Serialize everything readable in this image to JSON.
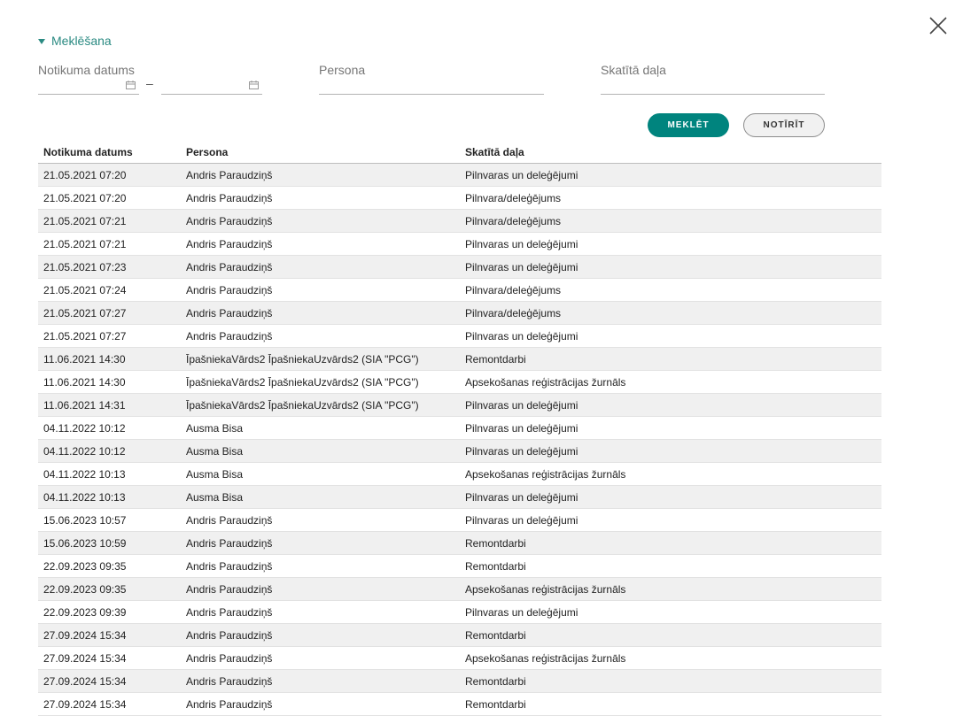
{
  "search": {
    "toggle_label": "Meklēšana",
    "date_label": "Notikuma datums",
    "date_separator": "–",
    "person_label": "Persona",
    "section_label": "Skatītā daļa",
    "search_button": "MEKLĒT",
    "clear_button": "NOTĪRĪT"
  },
  "icons": {
    "close": "close-icon",
    "calendar": "calendar-icon",
    "caret": "caret-down-icon"
  },
  "colors": {
    "accent": "#00847e",
    "link": "#2a8a82"
  },
  "table": {
    "headers": [
      "Notikuma datums",
      "Persona",
      "Skatītā daļa"
    ],
    "rows": [
      [
        "21.05.2021 07:20",
        "Andris Paraudziņš",
        "Pilnvaras un deleģējumi"
      ],
      [
        "21.05.2021 07:20",
        "Andris Paraudziņš",
        "Pilnvara/deleģējums"
      ],
      [
        "21.05.2021 07:21",
        "Andris Paraudziņš",
        "Pilnvara/deleģējums"
      ],
      [
        "21.05.2021 07:21",
        "Andris Paraudziņš",
        "Pilnvaras un deleģējumi"
      ],
      [
        "21.05.2021 07:23",
        "Andris Paraudziņš",
        "Pilnvaras un deleģējumi"
      ],
      [
        "21.05.2021 07:24",
        "Andris Paraudziņš",
        "Pilnvara/deleģējums"
      ],
      [
        "21.05.2021 07:27",
        "Andris Paraudziņš",
        "Pilnvara/deleģējums"
      ],
      [
        "21.05.2021 07:27",
        "Andris Paraudziņš",
        "Pilnvaras un deleģējumi"
      ],
      [
        "11.06.2021 14:30",
        "ĪpašniekaVārds2 ĪpašniekaUzvārds2 (SIA \"PCG\")",
        "Remontdarbi"
      ],
      [
        "11.06.2021 14:30",
        "ĪpašniekaVārds2 ĪpašniekaUzvārds2 (SIA \"PCG\")",
        "Apsekošanas reģistrācijas žurnāls"
      ],
      [
        "11.06.2021 14:31",
        "ĪpašniekaVārds2 ĪpašniekaUzvārds2 (SIA \"PCG\")",
        "Pilnvaras un deleģējumi"
      ],
      [
        "04.11.2022 10:12",
        "Ausma Bisa",
        "Pilnvaras un deleģējumi"
      ],
      [
        "04.11.2022 10:12",
        "Ausma Bisa",
        "Pilnvaras un deleģējumi"
      ],
      [
        "04.11.2022 10:13",
        "Ausma Bisa",
        "Apsekošanas reģistrācijas žurnāls"
      ],
      [
        "04.11.2022 10:13",
        "Ausma Bisa",
        "Pilnvaras un deleģējumi"
      ],
      [
        "15.06.2023 10:57",
        "Andris Paraudziņš",
        "Pilnvaras un deleģējumi"
      ],
      [
        "15.06.2023 10:59",
        "Andris Paraudziņš",
        "Remontdarbi"
      ],
      [
        "22.09.2023 09:35",
        "Andris Paraudziņš",
        "Remontdarbi"
      ],
      [
        "22.09.2023 09:35",
        "Andris Paraudziņš",
        "Apsekošanas reģistrācijas žurnāls"
      ],
      [
        "22.09.2023 09:39",
        "Andris Paraudziņš",
        "Pilnvaras un deleģējumi"
      ],
      [
        "27.09.2024 15:34",
        "Andris Paraudziņš",
        "Remontdarbi"
      ],
      [
        "27.09.2024 15:34",
        "Andris Paraudziņš",
        "Apsekošanas reģistrācijas žurnāls"
      ],
      [
        "27.09.2024 15:34",
        "Andris Paraudziņš",
        "Remontdarbi"
      ],
      [
        "27.09.2024 15:34",
        "Andris Paraudziņš",
        "Remontdarbi"
      ]
    ]
  }
}
